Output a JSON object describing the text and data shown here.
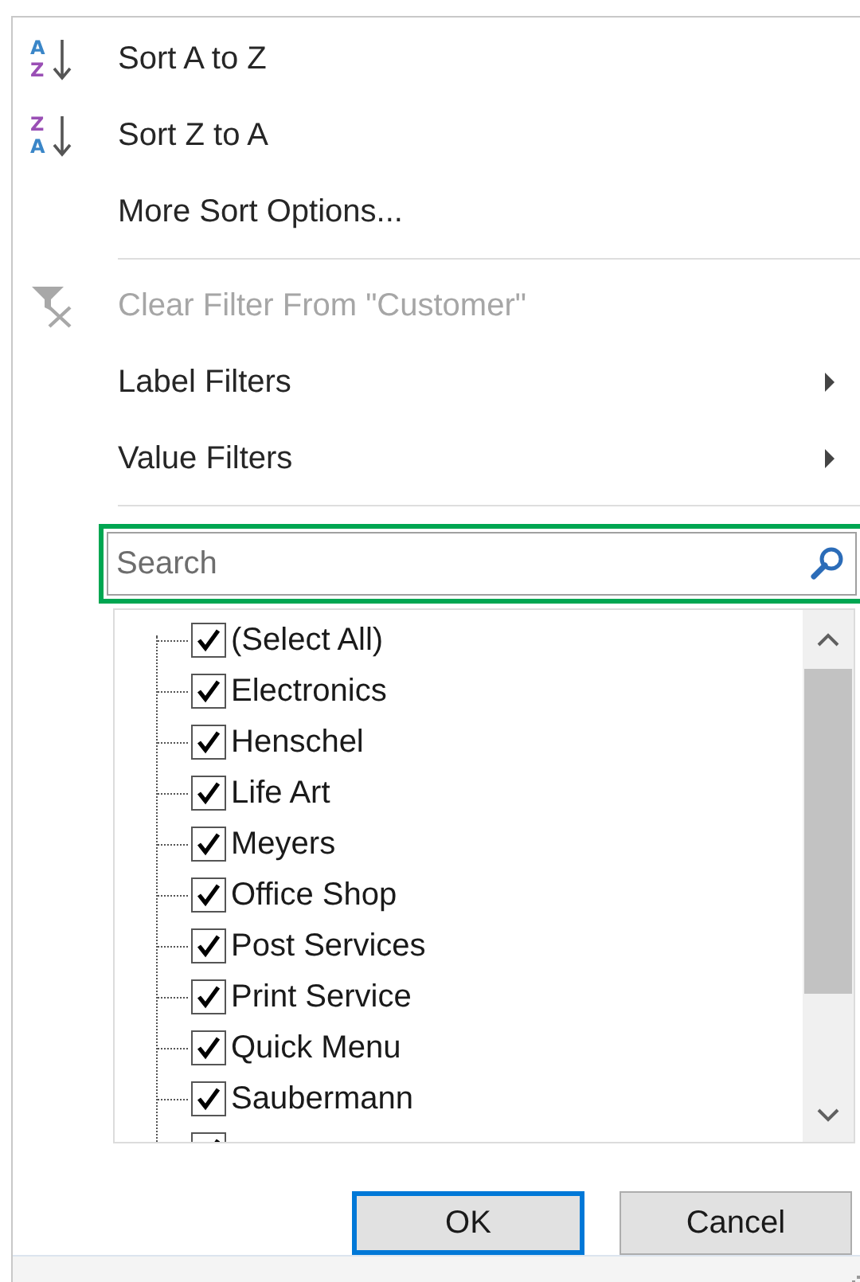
{
  "menu_items": [
    {
      "kind": "sort_az",
      "icon_letters": [
        "A",
        "Z"
      ],
      "label": "Sort A to Z",
      "disabled": false
    },
    {
      "kind": "sort_za",
      "icon_letters": [
        "Z",
        "A"
      ],
      "label": "Sort Z to A",
      "disabled": false
    },
    {
      "kind": "plain",
      "label": "More Sort Options...",
      "disabled": false
    },
    {
      "kind": "separator"
    },
    {
      "kind": "clear_filter",
      "label": "Clear Filter From \"Customer\"",
      "disabled": true
    },
    {
      "kind": "submenu",
      "label": "Label Filters",
      "disabled": false
    },
    {
      "kind": "submenu",
      "label": "Value Filters",
      "disabled": false
    },
    {
      "kind": "separator"
    }
  ],
  "search": {
    "placeholder": "Search",
    "focused": true
  },
  "filter_list": [
    {
      "label": "(Select All)",
      "checked": true
    },
    {
      "label": "Electronics",
      "checked": true
    },
    {
      "label": "Henschel",
      "checked": true
    },
    {
      "label": "Life Art",
      "checked": true
    },
    {
      "label": "Meyers",
      "checked": true
    },
    {
      "label": "Office Shop",
      "checked": true
    },
    {
      "label": "Post Services",
      "checked": true
    },
    {
      "label": "Print Service",
      "checked": true
    },
    {
      "label": "Quick Menu",
      "checked": true
    },
    {
      "label": "Saubermann",
      "checked": true
    },
    {
      "checked": true
    }
  ],
  "buttons": [
    {
      "label": "OK",
      "default": true
    },
    {
      "label": "Cancel",
      "default": false
    }
  ]
}
